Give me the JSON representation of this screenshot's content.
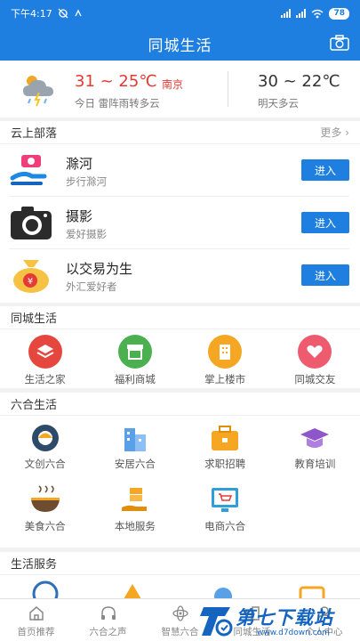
{
  "status_bar": {
    "time": "下午4:17",
    "battery": "78"
  },
  "title_bar": {
    "title": "同城生活"
  },
  "weather": {
    "today_temp": "31 ~ 25℃",
    "city": "南京",
    "today_desc": "今日 雷阵雨转多云",
    "tomorrow_temp": "30 ~ 22℃",
    "tomorrow_desc": "明天多云"
  },
  "cloud_tribe": {
    "title": "云上部落",
    "more": "更多",
    "items": [
      {
        "name": "滁河",
        "sub": "步行滁河",
        "button": "进入",
        "icon": "walking-person-icon"
      },
      {
        "name": "摄影",
        "sub": "爱好摄影",
        "button": "进入",
        "icon": "camera-icon"
      },
      {
        "name": "以交易为生",
        "sub": "外汇爱好者",
        "button": "进入",
        "icon": "money-bag-icon"
      }
    ]
  },
  "local_life": {
    "title": "同城生活",
    "items": [
      {
        "label": "生活之家",
        "icon": "layers-icon",
        "color": "#e5473e"
      },
      {
        "label": "福利商城",
        "icon": "shop-icon",
        "color": "#4caf50"
      },
      {
        "label": "掌上楼市",
        "icon": "building-icon",
        "color": "#f5a623"
      },
      {
        "label": "同城交友",
        "icon": "hearts-icon",
        "color": "#ef5b6e"
      }
    ]
  },
  "liuhe_life": {
    "title": "六合生活",
    "items": [
      {
        "label": "文创六合",
        "icon": "culture-icon"
      },
      {
        "label": "安居六合",
        "icon": "apartment-icon"
      },
      {
        "label": "求职招聘",
        "icon": "briefcase-icon"
      },
      {
        "label": "教育培训",
        "icon": "graduation-cap-icon"
      },
      {
        "label": "美食六合",
        "icon": "food-bowl-icon"
      },
      {
        "label": "本地服务",
        "icon": "service-hand-icon"
      },
      {
        "label": "电商六合",
        "icon": "shopping-screen-icon"
      }
    ]
  },
  "life_service": {
    "title": "生活服务"
  },
  "tab_bar": {
    "tabs": [
      {
        "label": "首页推荐",
        "icon": "home-icon"
      },
      {
        "label": "六合之声",
        "icon": "headphones-icon"
      },
      {
        "label": "智慧六合",
        "icon": "atom-icon"
      },
      {
        "label": "同城生活",
        "icon": "city-icon"
      },
      {
        "label": "个人中心",
        "icon": "person-icon"
      }
    ]
  },
  "watermark": {
    "title": "第七下载站",
    "url": "www.d7down.com"
  }
}
